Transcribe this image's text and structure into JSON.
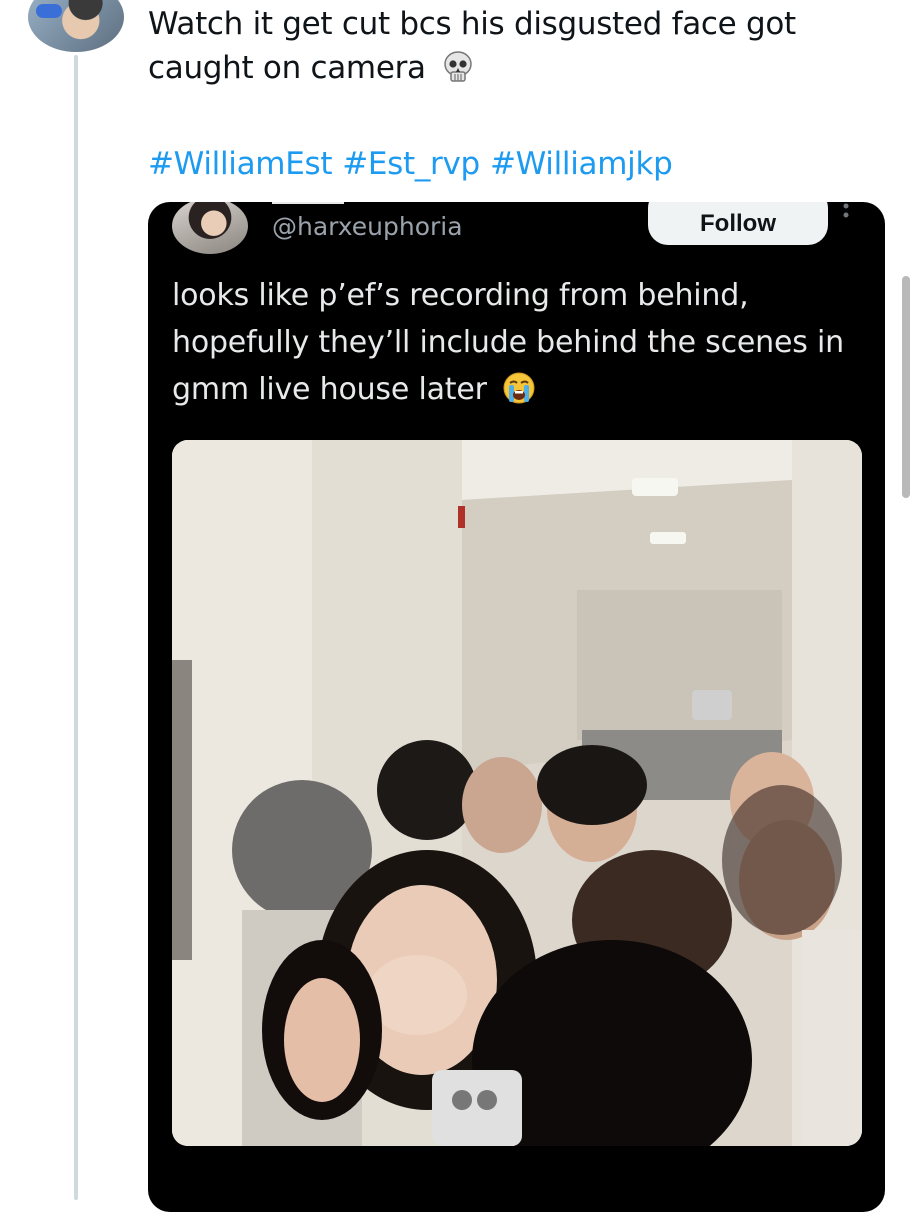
{
  "reply": {
    "text": "Watch it get cut bcs his disgusted face got caught on camera",
    "emoji": "💀",
    "emoji_icon": "skull-icon",
    "hashtags": [
      "#WilliamEst",
      "#Est_rvp",
      "#Williamjkp"
    ]
  },
  "quoted_post": {
    "handle": "@harxeuphoria",
    "follow_label": "Follow",
    "text": "looks like p’ef’s recording from behind, hopefully they’ll include behind the scenes in gmm live house later",
    "emoji": "😭",
    "emoji_icon": "loudly-crying-face-icon",
    "media_description_icon": "photo-icon"
  },
  "colors": {
    "link": "#1d9bf0",
    "text": "#0f1419",
    "card_bg": "#000000",
    "card_text": "#e7e9ea",
    "muted": "#71767b",
    "thread_line": "#cfd9de"
  }
}
